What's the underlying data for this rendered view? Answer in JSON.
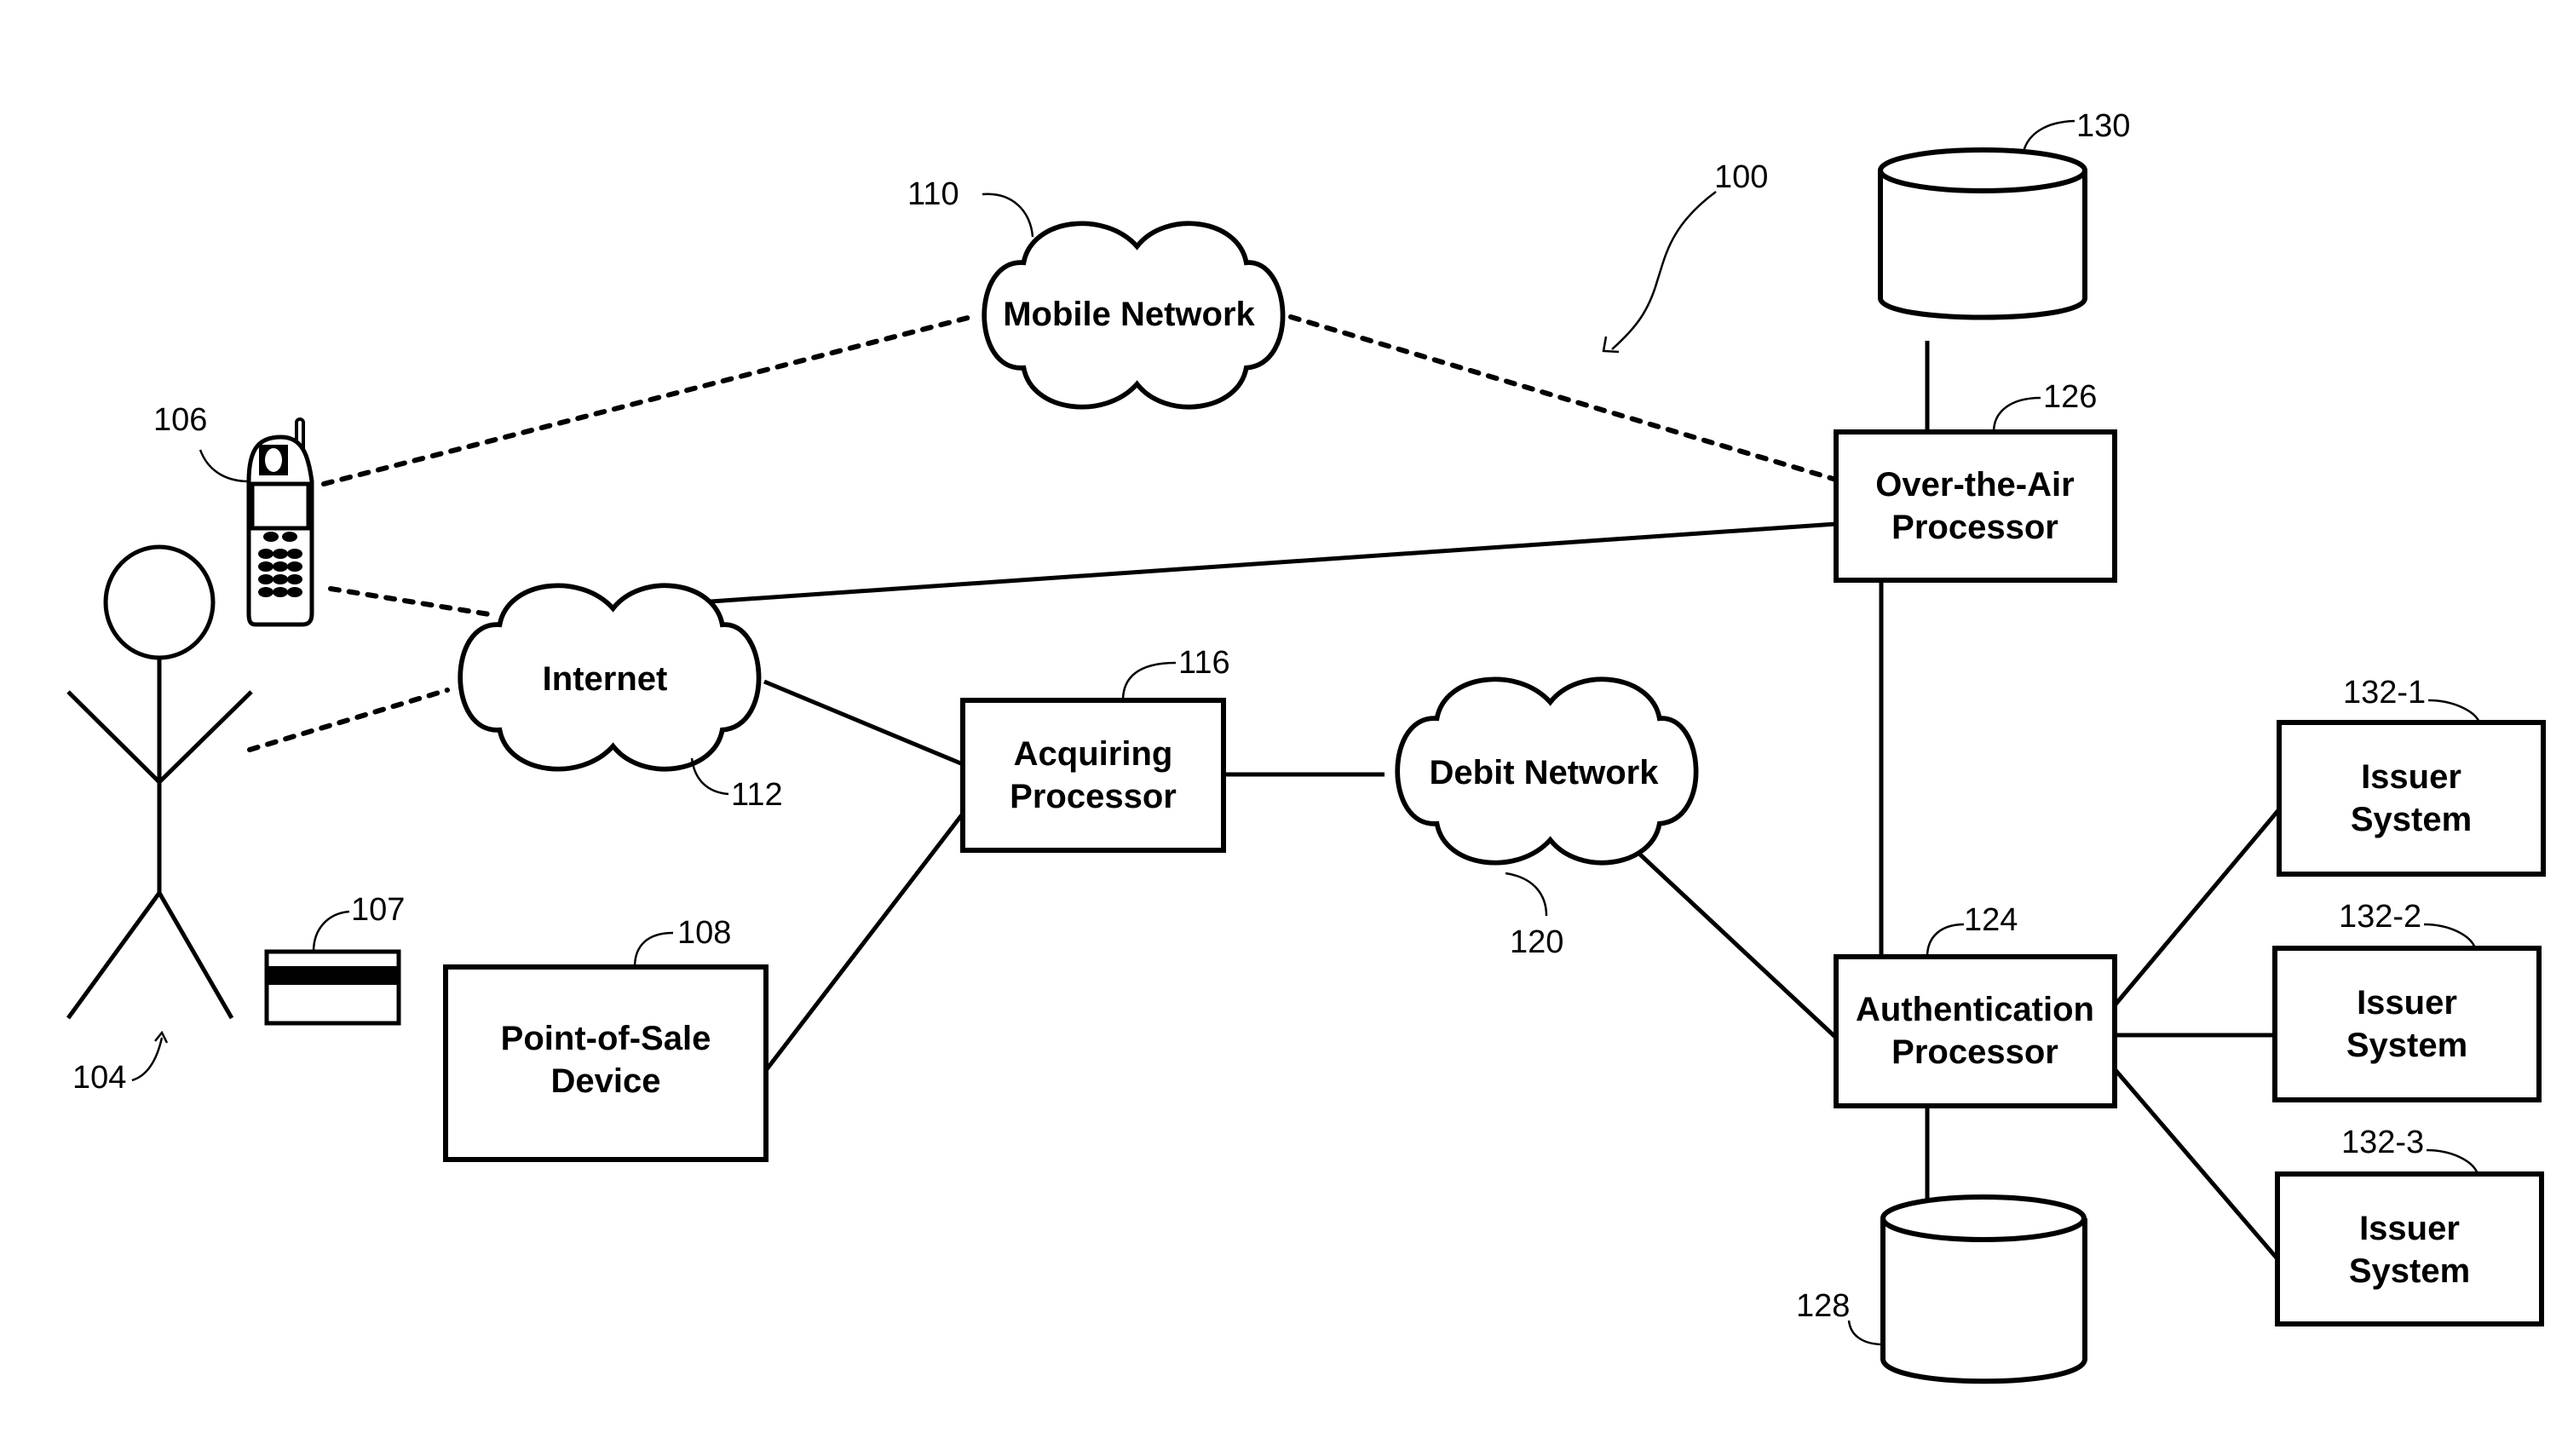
{
  "figure": {
    "ref": "100",
    "user": {
      "ref": "104"
    },
    "phone": {
      "ref": "106"
    },
    "card": {
      "ref": "107"
    },
    "pos": {
      "ref": "108",
      "line1": "Point-of-Sale",
      "line2": "Device"
    },
    "mobile_network": {
      "ref": "110",
      "label": "Mobile Network"
    },
    "internet": {
      "ref": "112",
      "label": "Internet"
    },
    "acquiring": {
      "ref": "116",
      "line1": "Acquiring",
      "line2": "Processor"
    },
    "debit_network": {
      "ref": "120",
      "label": "Debit Network"
    },
    "auth": {
      "ref": "124",
      "line1": "Authentication",
      "line2": "Processor"
    },
    "ota": {
      "ref": "126",
      "line1": "Over-the-Air",
      "line2": "Processor"
    },
    "db_auth": {
      "ref": "128"
    },
    "db_ota": {
      "ref": "130"
    },
    "issuers": [
      {
        "ref": "132-1",
        "line1": "Issuer",
        "line2": "System"
      },
      {
        "ref": "132-2",
        "line1": "Issuer",
        "line2": "System"
      },
      {
        "ref": "132-3",
        "line1": "Issuer",
        "line2": "System"
      }
    ]
  }
}
